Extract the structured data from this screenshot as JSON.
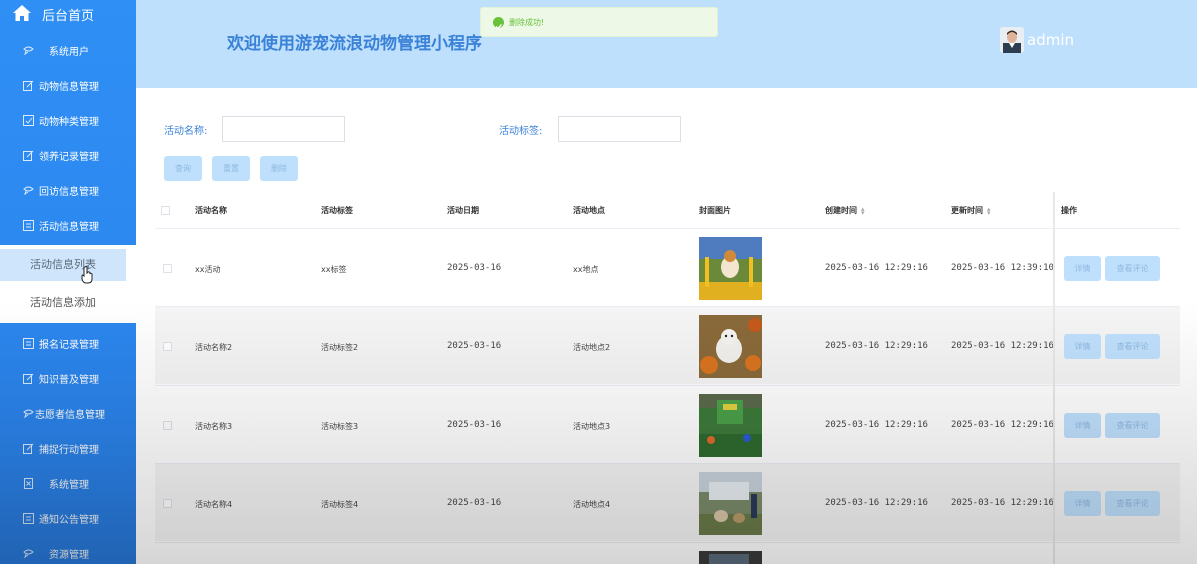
{
  "sidebar": {
    "home_label": "后台首页",
    "items": [
      {
        "label": "系统用户",
        "icon": "chat-bubble-icon"
      },
      {
        "label": "动物信息管理",
        "icon": "edit-icon"
      },
      {
        "label": "动物种类管理",
        "icon": "edit-icon"
      },
      {
        "label": "领养记录管理",
        "icon": "edit-icon"
      },
      {
        "label": "回访信息管理",
        "icon": "chat-bubble-icon"
      },
      {
        "label": "活动信息管理",
        "icon": "edit-icon"
      },
      {
        "label": "报名记录管理",
        "icon": "edit-icon"
      },
      {
        "label": "知识普及管理",
        "icon": "edit-icon"
      },
      {
        "label": "志愿者信息管理",
        "icon": "chat-bubble-icon"
      },
      {
        "label": "捕捉行动管理",
        "icon": "edit-icon"
      },
      {
        "label": "系统管理",
        "icon": "document-icon"
      },
      {
        "label": "通知公告管理",
        "icon": "edit-icon"
      },
      {
        "label": "资源管理",
        "icon": "chat-bubble-icon"
      }
    ],
    "submenu": [
      {
        "label": "活动信息列表"
      },
      {
        "label": "活动信息添加"
      }
    ]
  },
  "header": {
    "title": "欢迎使用游宠流浪动物管理小程序",
    "user": "admin"
  },
  "toast": {
    "text": "删除成功!"
  },
  "search": {
    "name_label": "活动名称:",
    "tag_label": "活动标签:",
    "query": "查询",
    "reset": "重置",
    "delete": "删除"
  },
  "table": {
    "columns": [
      "活动名称",
      "活动标签",
      "活动日期",
      "活动地点",
      "封面图片",
      "创建时间",
      "更新时间",
      "操作"
    ],
    "rows": [
      {
        "name": "xx活动",
        "tag": "xx标签",
        "date": "2025-03-16",
        "place": "xx地点",
        "created": "2025-03-16 12:29:16",
        "updated": "2025-03-16 12:39:10"
      },
      {
        "name": "活动名称2",
        "tag": "活动标签2",
        "date": "2025-03-16",
        "place": "活动地点2",
        "created": "2025-03-16 12:29:16",
        "updated": "2025-03-16 12:29:16"
      },
      {
        "name": "活动名称3",
        "tag": "活动标签3",
        "date": "2025-03-16",
        "place": "活动地点3",
        "created": "2025-03-16 12:29:16",
        "updated": "2025-03-16 12:29:16"
      },
      {
        "name": "活动名称4",
        "tag": "活动标签4",
        "date": "2025-03-16",
        "place": "活动地点4",
        "created": "2025-03-16 12:29:16",
        "updated": "2025-03-16 12:29:16"
      }
    ],
    "detail_label": "详情",
    "comment_label": "查看评论"
  },
  "colors": {
    "sidebar": "#2f8ff5",
    "header": "#bfe0fd",
    "accent": "#3a82d8",
    "button": "#bfe0fd",
    "success": "#67c23a"
  }
}
